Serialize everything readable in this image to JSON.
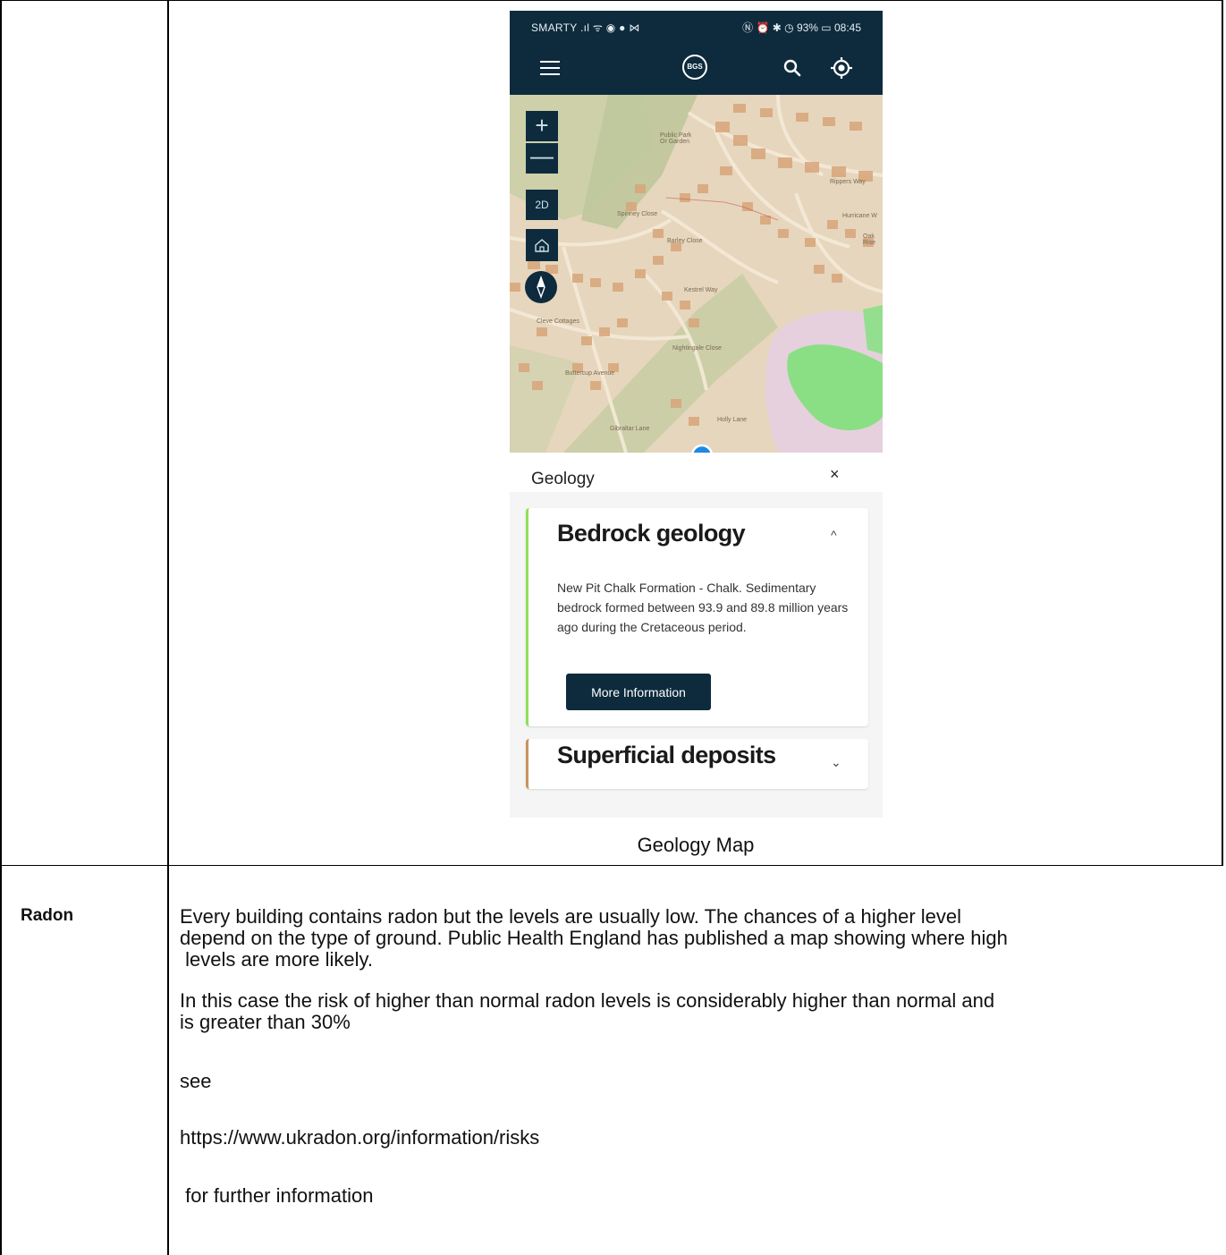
{
  "phone": {
    "status_left": "SMARTY .ıl ᯤ ◉ ● ⋈",
    "status_right": "Ⓝ ⏰ ✱ ◷ 93% ▭ 08:45",
    "logo_text": "BGS",
    "map_labels": [
      "Public Park Or Garden",
      "Rippers Way",
      "Hurricane W",
      "Oak Rise",
      "Spinney Close",
      "Barley Close",
      "Kestrel Way",
      "Nightingale Close",
      "Cleve Cottages",
      "Buttercup Avenue",
      "Gibraltar Lane",
      "Holly Lane"
    ],
    "map_controls": {
      "zoom_in": "+",
      "zoom_out": "—",
      "mode": "2D"
    },
    "panel_title": "Geology",
    "close_symbol": "×",
    "bedrock": {
      "title": "Bedrock geology",
      "chevron": "^",
      "description": "New Pit Chalk Formation - Chalk. Sedimentary bedrock formed between 93.9 and 89.8 million years ago during the Cretaceous period.",
      "button": "More Information",
      "accent": "#8fe05a"
    },
    "superficial": {
      "title": "Superficial deposits",
      "chevron": "⌄",
      "accent": "#c9935c"
    },
    "theme_color": "#0d2b3d"
  },
  "caption": "Geology Map",
  "radon": {
    "label": "Radon",
    "para1_line1": "Every building contains radon but the levels are usually low. The chances of a higher level",
    "para1_line2": "depend on the type of ground. Public Health England has published a map showing where high",
    "para1_line3": " levels are more likely.",
    "para2_line1": "In this case the risk of higher than normal radon levels is considerably higher than normal and",
    "para2_line2": "is greater than 30%",
    "see": "see",
    "link": "https://www.ukradon.org/information/risks",
    "further": " for further information"
  }
}
